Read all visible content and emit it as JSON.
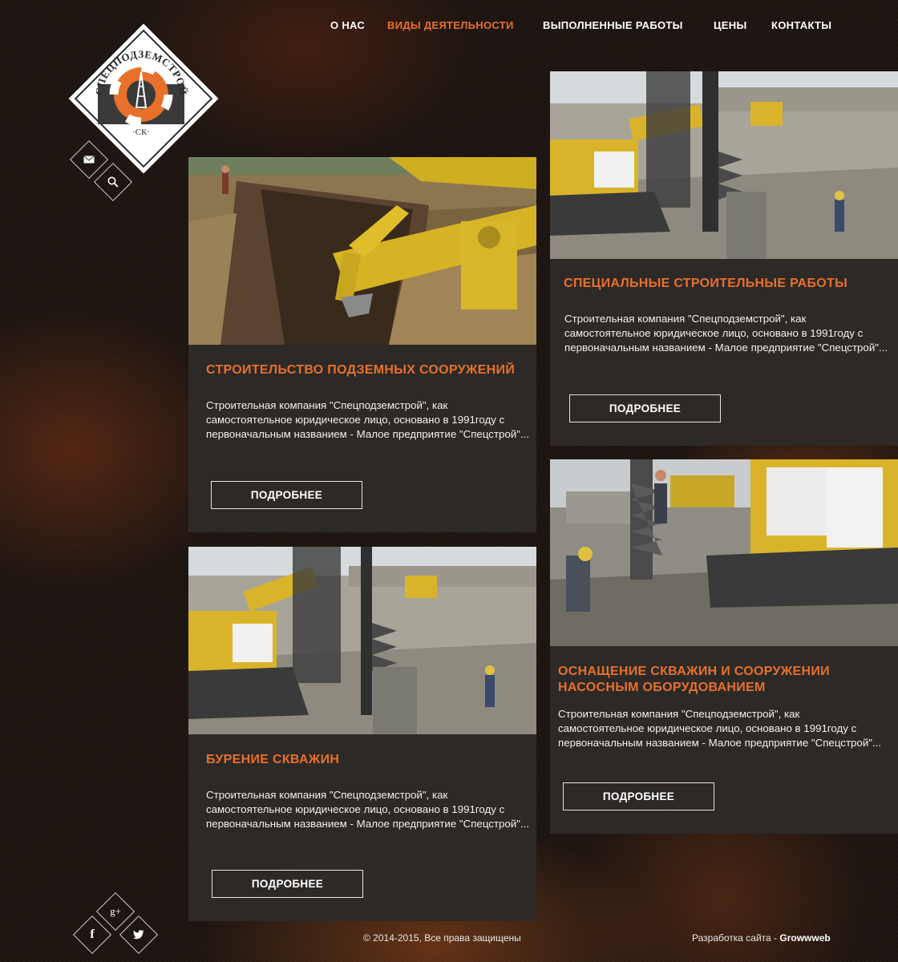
{
  "nav": {
    "items": [
      {
        "label": "О НАС",
        "active": false
      },
      {
        "label": "ВИДЫ ДЕЯТЕЛЬНОСТИ",
        "active": true
      },
      {
        "label": "ВЫПОЛНЕННЫЕ РАБОТЫ",
        "active": false
      },
      {
        "label": "ЦЕНЫ",
        "active": false
      },
      {
        "label": "КОНТАКТЫ",
        "active": false
      }
    ]
  },
  "logo": {
    "arc_text": "СПЕЦПОДЗЕМСТРОЙ",
    "initials": "·СК·"
  },
  "tools": {
    "mail_icon": "envelope-icon",
    "search_icon": "search-icon"
  },
  "cards": [
    {
      "title": "СТРОИТЕЛЬСТВО ПОДЗЕМНЫХ СООРУЖЕНИЙ",
      "text": "Строительная компания \"Спецподземстрой\", как самостоятельное юридическое лицо, основано в 1991году с первоначальным названием - Малое предприятие \"Спецстрой\"...",
      "button": "ПОДРОБНЕЕ"
    },
    {
      "title": "СПЕЦИАЛЬНЫЕ СТРОИТЕЛЬНЫЕ РАБОТЫ",
      "text": "Строительная компания \"Спецподземстрой\", как самостоятельное юридическое лицо, основано в 1991году с первоначальным названием - Малое предприятие \"Спецстрой\"...",
      "button": "ПОДРОБНЕЕ"
    },
    {
      "title": "БУРЕНИЕ СКВАЖИН",
      "text": "Строительная компания \"Спецподземстрой\", как самостоятельное юридическое лицо, основано в 1991году с первоначальным названием - Малое предприятие \"Спецстрой\"...",
      "button": "ПОДРОБНЕЕ"
    },
    {
      "title": "ОСНАЩЕНИЕ СКВАЖИН И СООРУЖЕНИИ НАСОСНЫМ ОБОРУДОВАНИЕМ",
      "text": "Строительная компания \"Спецподземстрой\", как самостоятельное юридическое лицо, основано в 1991году с первоначальным названием - Малое предприятие \"Спецстрой\"...",
      "button": "ПОДРОБНЕЕ"
    }
  ],
  "social": {
    "gplus": "g+",
    "facebook": "f",
    "twitter": "twitter-icon"
  },
  "footer": {
    "copyright": "© 2014-2015, Все права защищены",
    "dev_prefix": "Разработка сайта - ",
    "dev_name": "Growwweb"
  },
  "colors": {
    "accent": "#e8702a",
    "card_bg": "#2d2a28",
    "page_bg": "#1d1410"
  }
}
